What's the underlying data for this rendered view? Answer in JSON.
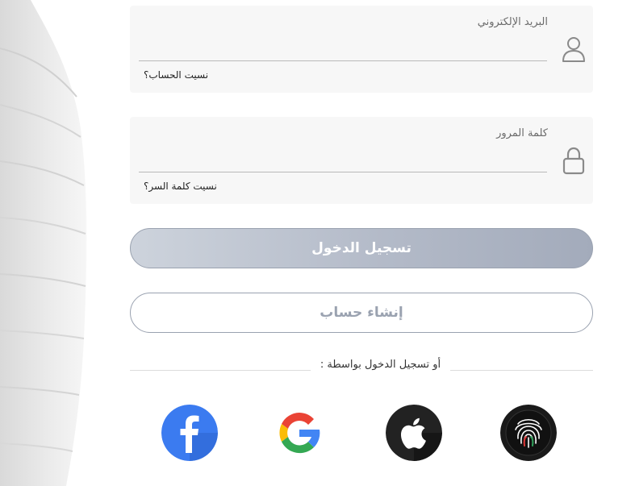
{
  "email_field": {
    "label": "البريد الإلكتروني",
    "value": "",
    "forgot_link": "نسيت الحساب؟"
  },
  "password_field": {
    "label": "كلمة المرور",
    "value": "",
    "forgot_link": "نسيت كلمة السر؟"
  },
  "buttons": {
    "login_label": "تسجيل الدخول",
    "register_label": "إنشاء حساب"
  },
  "social_login": {
    "divider_text": "أو تسجيل الدخول بواسطة :",
    "providers": [
      "facebook-icon",
      "google-icon",
      "apple-icon",
      "uae-pass-fingerprint-icon"
    ]
  },
  "colors": {
    "accent": "#9aa2b0",
    "facebook_blue": "#3b7bf0",
    "field_bg": "#f7f7f7"
  }
}
